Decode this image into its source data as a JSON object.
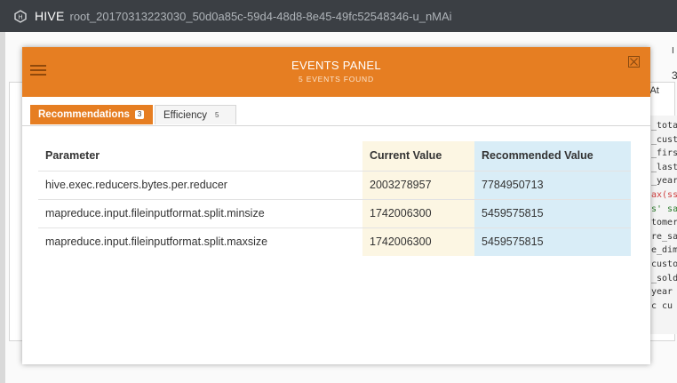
{
  "appbar": {
    "brand": "HIVE",
    "query_id": "root_20170313223030_50d0a85c-59d4-48d8-8e45-49fc52548346-u_nMAi",
    "logo_icon": "hive-hexagon-icon"
  },
  "background": {
    "tab_peek": "sk At",
    "right_peek_1": "I",
    "right_peek_2": "3",
    "code_lines": [
      "_tota",
      "_cust",
      "_firs",
      "_last",
      "_year",
      "ax(ss",
      "s' sa",
      "tomer",
      "re_sa",
      "e_dim",
      "custo",
      "_sold",
      "year",
      " c cu"
    ]
  },
  "modal": {
    "title": "EVENTS PANEL",
    "subtitle": "5 EVENTS FOUND",
    "tabs": [
      {
        "label": "Recommendations",
        "count": "3",
        "active": true
      },
      {
        "label": "Efficiency",
        "count": "5",
        "active": false
      }
    ],
    "table": {
      "headers": [
        "Parameter",
        "Current Value",
        "Recommended Value"
      ],
      "rows": [
        {
          "parameter": "hive.exec.reducers.bytes.per.reducer",
          "current": "2003278957",
          "recommended": "7784950713"
        },
        {
          "parameter": "mapreduce.input.fileinputformat.split.minsize",
          "current": "1742006300",
          "recommended": "5459575815"
        },
        {
          "parameter": "mapreduce.input.fileinputformat.split.maxsize",
          "current": "1742006300",
          "recommended": "5459575815"
        }
      ]
    }
  },
  "colors": {
    "accent": "#e67e22",
    "current_bg": "#fcf6e3",
    "recommended_bg": "#d9edf7",
    "appbar_bg": "#3b3f44"
  }
}
